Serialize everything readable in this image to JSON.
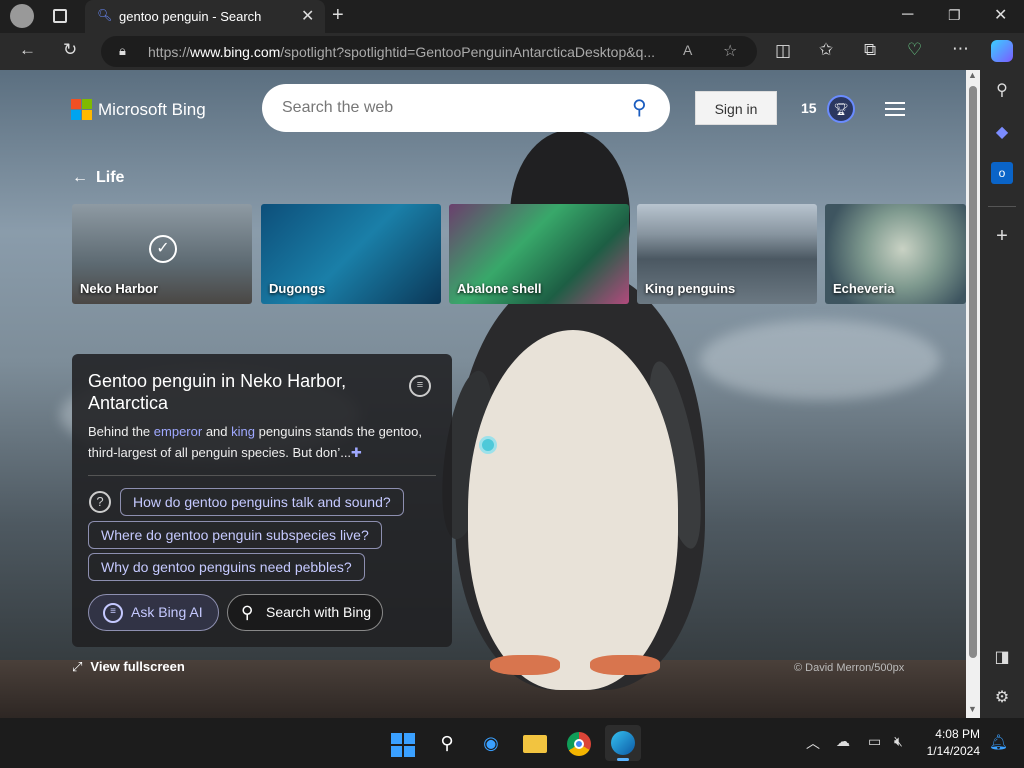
{
  "browser": {
    "tab_title": "gentoo penguin - Search",
    "url_prefix": "https://",
    "url_domain": "www.bing.com",
    "url_rest": "/spotlight?spotlightid=GentooPenguinAntarcticaDesktop&q...",
    "icons": [
      "profile-icon",
      "tab-actions-icon",
      "search-icon",
      "close-icon",
      "new-tab-icon",
      "minimize-icon",
      "restore-icon",
      "window-close-icon",
      "back-icon",
      "refresh-icon",
      "lock-icon",
      "read-aloud-icon",
      "favorite-icon",
      "split-screen-icon",
      "favorites-icon",
      "collections-icon",
      "performance-icon",
      "more-icon",
      "copilot-icon"
    ]
  },
  "bing": {
    "logo_text": "Microsoft Bing",
    "search_placeholder": "Search the web",
    "sign_in": "Sign in",
    "points": "15",
    "colors": {
      "red": "#f25022",
      "green": "#7fba00",
      "blue": "#00a4ef",
      "yellow": "#ffb900"
    }
  },
  "carousel": {
    "back_label": "Life",
    "cards": [
      {
        "label": "Neko Harbor",
        "selected": true
      },
      {
        "label": "Dugongs"
      },
      {
        "label": "Abalone shell"
      },
      {
        "label": "King penguins"
      },
      {
        "label": "Echeveria"
      }
    ]
  },
  "panel": {
    "title": "Gentoo penguin in Neko Harbor, Antarctica",
    "desc_pre": "Behind the ",
    "link1": "emperor",
    "desc_mid": " and ",
    "link2": "king",
    "desc_post": " penguins stands the gentoo, third-largest of all penguin species. But don’...",
    "questions": [
      "How do gentoo penguins talk and sound?",
      "Where do gentoo penguin subspecies live?",
      "Why do gentoo penguins need pebbles?"
    ],
    "ask_bing": "Ask Bing AI",
    "search_bing": "Search with Bing"
  },
  "footer": {
    "fullscreen": "View fullscreen",
    "credit": "© David Merron/500px"
  },
  "taskbar": {
    "time": "4:08 PM",
    "date": "1/14/2024"
  }
}
